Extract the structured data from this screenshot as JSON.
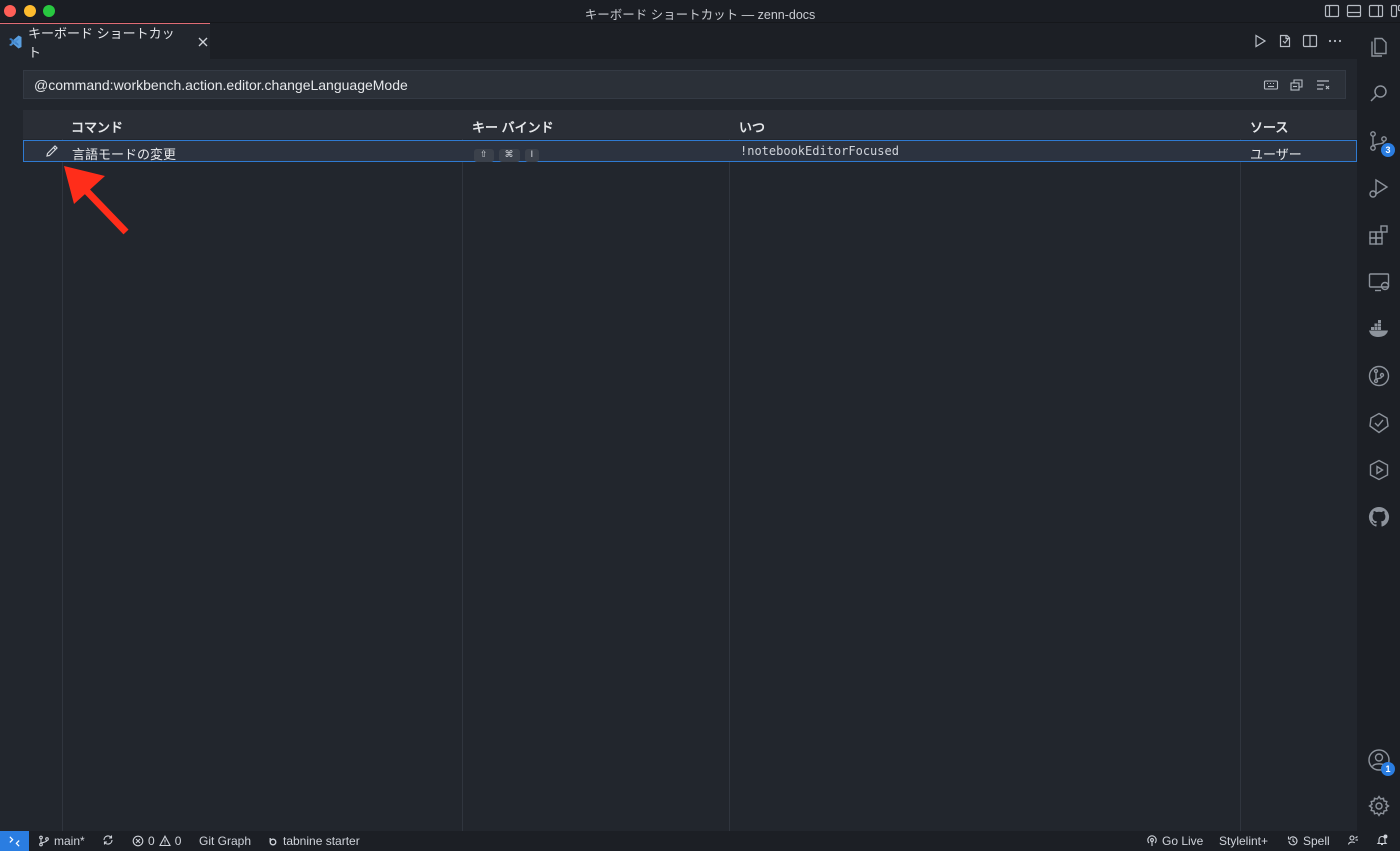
{
  "window": {
    "title": "キーボード ショートカット — zenn-docs"
  },
  "tab": {
    "label": "キーボード ショートカット"
  },
  "search": {
    "value": "@command:workbench.action.editor.changeLanguageMode"
  },
  "table": {
    "headers": {
      "command": "コマンド",
      "keybinding": "キー バインド",
      "when": "いつ",
      "source": "ソース"
    },
    "rows": [
      {
        "command": "言語モードの変更",
        "keys": [
          "⇧",
          "⌘",
          "I"
        ],
        "when": "!notebookEditorFocused",
        "source": "ユーザー"
      }
    ]
  },
  "activity": {
    "scm_badge": "3",
    "accounts_badge": "1"
  },
  "status": {
    "branch": "main*",
    "errors": "0",
    "warnings": "0",
    "git_graph": "Git Graph",
    "tabnine": "tabnine starter",
    "go_live": "Go Live",
    "stylelint": "Stylelint+",
    "spell": "Spell"
  },
  "colors": {
    "accent": "#2a7de1",
    "row_selected_border": "#2f7ad1",
    "annotation_arrow": "#ff2d1a"
  }
}
